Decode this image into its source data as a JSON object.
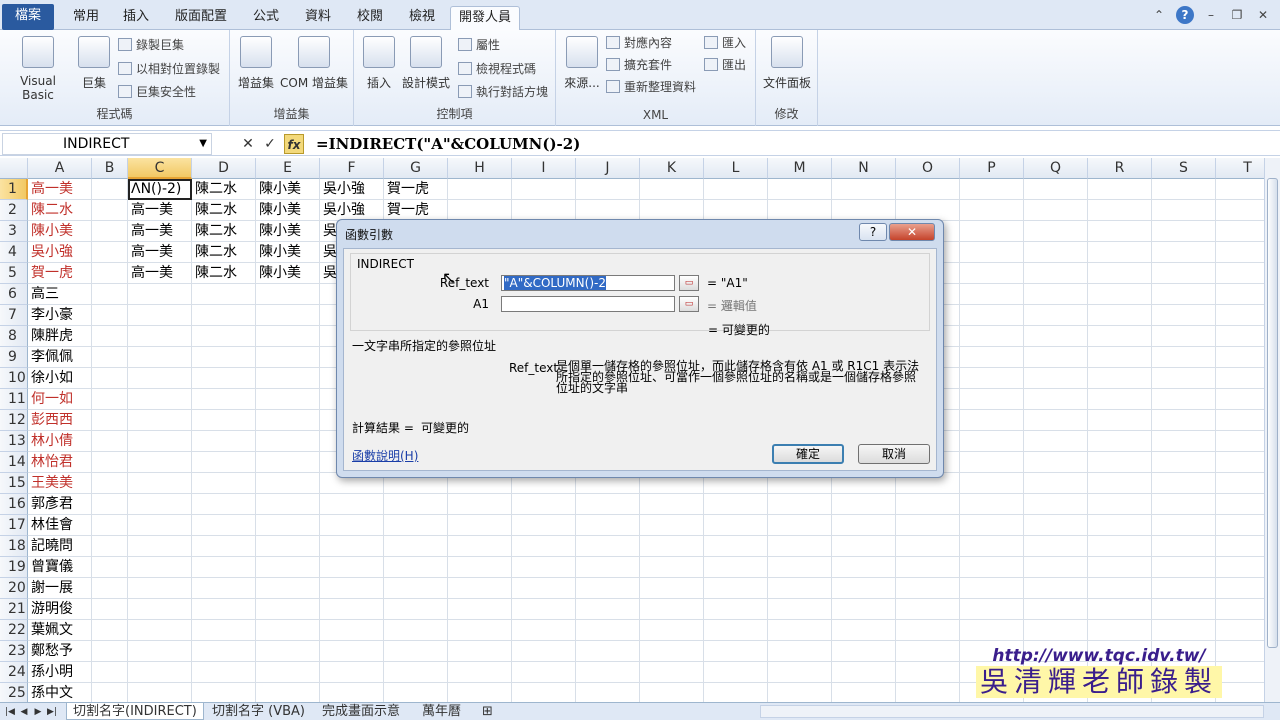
{
  "tabs": [
    "檔案",
    "常用",
    "插入",
    "版面配置",
    "公式",
    "資料",
    "校閱",
    "檢視",
    "開發人員"
  ],
  "ribbon": {
    "groups": [
      {
        "label": "程式碼",
        "big": [
          "Visual Basic",
          "巨集"
        ],
        "small": [
          "錄製巨集",
          "以相對位置錄製",
          "巨集安全性"
        ]
      },
      {
        "label": "增益集",
        "big": [
          "增益集",
          "COM 增益集"
        ]
      },
      {
        "label": "控制項",
        "big": [
          "插入",
          "設計模式"
        ],
        "small": [
          "屬性",
          "檢視程式碼",
          "執行對話方塊"
        ]
      },
      {
        "label": "XML",
        "big": [
          "來源..."
        ],
        "small": [
          "對應內容",
          "擴充套件",
          "重新整理資料",
          "匯入",
          "匯出"
        ]
      },
      {
        "label": "修改",
        "big": [
          "文件面板"
        ]
      }
    ]
  },
  "formula_bar": {
    "name_box": "INDIRECT",
    "cancel": "✕",
    "enter": "✓",
    "fx": "fx",
    "formula": "=INDIRECT(\"A\"&COLUMN()-2)"
  },
  "columns": [
    "A",
    "B",
    "C",
    "D",
    "E",
    "F",
    "G",
    "H",
    "I",
    "J",
    "K",
    "L",
    "M",
    "N",
    "O",
    "P",
    "Q",
    "R",
    "S",
    "T"
  ],
  "rows": [
    "1",
    "2",
    "3",
    "4",
    "5",
    "6",
    "7",
    "8",
    "9",
    "10",
    "11",
    "12",
    "13",
    "14",
    "15",
    "16",
    "17",
    "18",
    "19",
    "20",
    "21",
    "22",
    "23",
    "24",
    "25"
  ],
  "col_a": [
    {
      "v": "高一美",
      "red": true
    },
    {
      "v": "陳二水",
      "red": true
    },
    {
      "v": "陳小美",
      "red": true
    },
    {
      "v": "吳小強",
      "red": true
    },
    {
      "v": "賀一虎",
      "red": true
    },
    {
      "v": "高三",
      "red": false
    },
    {
      "v": "李小豪",
      "red": false
    },
    {
      "v": "陳胖虎",
      "red": false
    },
    {
      "v": "李佩佩",
      "red": false
    },
    {
      "v": "徐小如",
      "red": false
    },
    {
      "v": "何一如",
      "red": true
    },
    {
      "v": "彭西西",
      "red": true
    },
    {
      "v": "林小倩",
      "red": true
    },
    {
      "v": "林怡君",
      "red": true
    },
    {
      "v": "王美美",
      "red": true
    },
    {
      "v": "郭彥君",
      "red": false
    },
    {
      "v": "林佳會",
      "red": false
    },
    {
      "v": "記曉問",
      "red": false
    },
    {
      "v": "曾寶儀",
      "red": false
    },
    {
      "v": "謝一展",
      "red": false
    },
    {
      "v": "游明俊",
      "red": false
    },
    {
      "v": "葉姵文",
      "red": false
    },
    {
      "v": "鄭愁予",
      "red": false
    },
    {
      "v": "孫小明",
      "red": false
    },
    {
      "v": "孫中文",
      "red": false
    }
  ],
  "range_rows": [
    [
      "ΛN()-2)",
      "陳二水",
      "陳小美",
      "吳小強",
      "賀一虎"
    ],
    [
      "高一美",
      "陳二水",
      "陳小美",
      "吳小強",
      "賀一虎"
    ],
    [
      "高一美",
      "陳二水",
      "陳小美",
      "吳",
      ""
    ],
    [
      "高一美",
      "陳二水",
      "陳小美",
      "吳",
      ""
    ],
    [
      "高一美",
      "陳二水",
      "陳小美",
      "吳",
      ""
    ]
  ],
  "sheets": [
    "切割名字(INDIRECT)",
    "切割名字 (VBA)",
    "完成畫面示意",
    "萬年曆"
  ],
  "dialog": {
    "title": "函數引數",
    "help": "?",
    "close": "✕",
    "function_name": "INDIRECT",
    "args": [
      {
        "label": "Ref_text",
        "value": "\"A\"&COLUMN()-2",
        "result": "= \"A1\""
      },
      {
        "label": "A1",
        "value": "",
        "result": "= 邏輯值"
      }
    ],
    "overall_result": "= 可變更的",
    "description": "一文字串所指定的參照位址",
    "arg_name": "Ref_text",
    "arg_desc": "是個單一儲存格的參照位址，而此儲存格含有依 A1 或 R1C1 表示法所指定的參照位址、可當作一個參照位址的名稱或是一個儲存格參照位址的文字串",
    "calc_label": "計算結果 =",
    "calc_value": "可變更的",
    "help_link": "函數說明(H)",
    "ok": "確定",
    "cancel": "取消"
  },
  "watermark": {
    "url": "http://www.tqc.idv.tw/",
    "name": "吳清輝老師錄製"
  }
}
